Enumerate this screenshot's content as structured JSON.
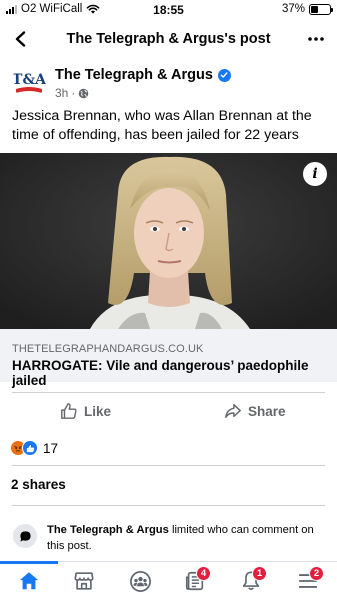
{
  "status_bar": {
    "carrier": "O2 WiFiCall",
    "time": "18:55",
    "battery": "37%",
    "battery_level": 0.37
  },
  "header": {
    "title": "The Telegraph & Argus's post"
  },
  "post": {
    "page_name": "The Telegraph & Argus",
    "avatar_logo": "T&A",
    "time": "3h",
    "verified": true,
    "audience_icon": "globe-icon",
    "text": "Jessica Brennan, who was Allan Brennan at the time of offending, has been jailed for 22 years"
  },
  "image": {
    "info_label": "i"
  },
  "link": {
    "domain": "THETELEGRAPHANDARGUS.CO.UK",
    "title": "HARROGATE: Vile and dangerous’ paedophile jailed"
  },
  "actions": {
    "like": "Like",
    "share": "Share"
  },
  "reactions": {
    "types": [
      "angry",
      "like"
    ],
    "count": "17"
  },
  "shares": "2 shares",
  "comment_notice": {
    "page_name": "The Telegraph & Argus",
    "text": " limited who can comment on this post."
  },
  "bottom_nav": {
    "items": [
      {
        "icon": "home-icon",
        "badge": null,
        "active": true
      },
      {
        "icon": "marketplace-icon",
        "badge": null,
        "active": false
      },
      {
        "icon": "groups-icon",
        "badge": null,
        "active": false
      },
      {
        "icon": "news-icon",
        "badge": "4",
        "active": false
      },
      {
        "icon": "bell-icon",
        "badge": "1",
        "active": false
      },
      {
        "icon": "menu-icon",
        "badge": "2",
        "active": false
      }
    ]
  },
  "colors": {
    "brand_blue": "#1877f2",
    "badge_red": "#e41e3f",
    "secondary_text": "#65676b",
    "angry_orange": "#e9710f"
  }
}
